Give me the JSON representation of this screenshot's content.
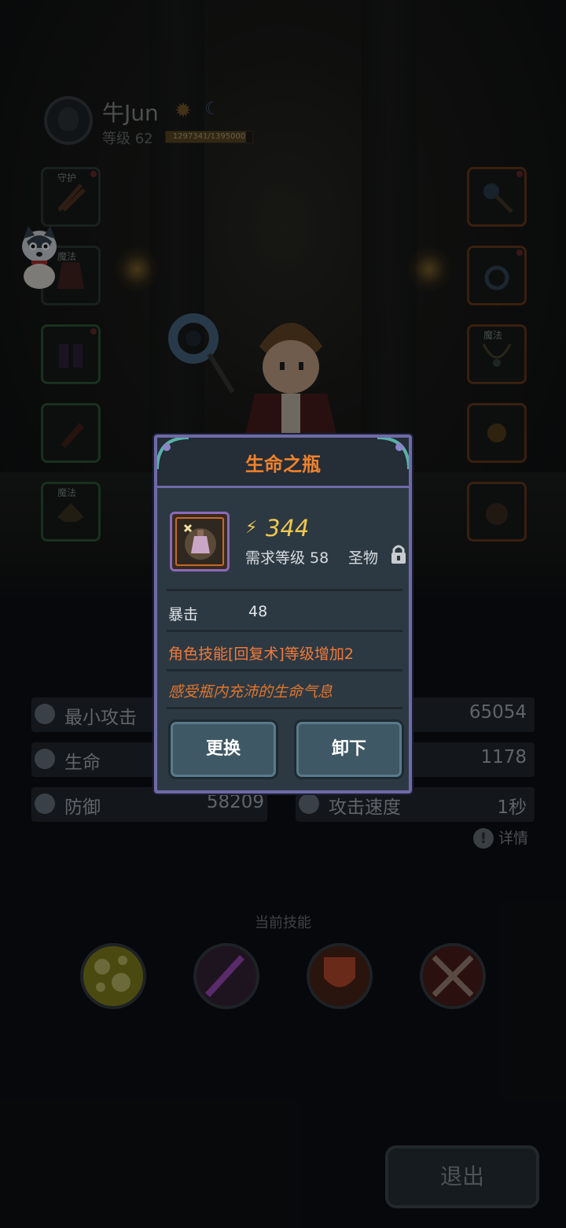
{
  "player": {
    "name": "牛Jun",
    "level_label": "等级 62",
    "xp_text": "1297341/1395000",
    "xp_fraction": 0.93,
    "rank_icon": "sun-badge-icon",
    "moon_icon": "crescent-moon-icon"
  },
  "equipment": {
    "left_slots": [
      {
        "name": "slot-guard-weapon",
        "tag": "守护",
        "icon": "twin-blades-icon"
      },
      {
        "name": "slot-armor",
        "tag": "魔法",
        "icon": "robe-icon"
      },
      {
        "name": "slot-boots",
        "tag": "",
        "icon": "boots-icon"
      },
      {
        "name": "slot-bracer",
        "tag": "",
        "icon": "bracer-icon"
      },
      {
        "name": "slot-helmet",
        "tag": "魔法",
        "icon": "helmet-icon"
      }
    ],
    "right_slots": [
      {
        "name": "slot-staff",
        "tag": "",
        "icon": "staff-icon"
      },
      {
        "name": "slot-ring",
        "tag": "",
        "icon": "ring-icon"
      },
      {
        "name": "slot-necklace",
        "tag": "魔法",
        "icon": "necklace-icon"
      },
      {
        "name": "slot-amulet",
        "tag": "",
        "icon": "amulet-icon"
      },
      {
        "name": "slot-relic",
        "tag": "",
        "icon": "bottle-icon"
      }
    ]
  },
  "stats": {
    "min_attack_label": "最小攻击",
    "min_attack_value": "65054",
    "hp_label": "生命",
    "hp_value": "1178",
    "defense_label": "防御",
    "defense_value": "58209",
    "attack_speed_label": "攻击速度",
    "attack_speed_value": "1秒",
    "details_label": "详情"
  },
  "skills": {
    "title": "当前技能",
    "icons": [
      "bubbles-skill-icon",
      "dark-sword-skill-icon",
      "fire-shield-skill-icon",
      "crossed-axes-skill-icon"
    ]
  },
  "exit_label": "退出",
  "dialog": {
    "title": "生命之瓶",
    "power": "344",
    "requirement": "需求等级 58",
    "rarity": "圣物",
    "attribute_label": "暴击",
    "attribute_value": "48",
    "effect": "角色技能[回复术]等级增加2",
    "flavor": "感受瓶内充沛的生命气息",
    "replace_label": "更换",
    "unequip_label": "卸下"
  },
  "colors": {
    "dialog_bg": "#2d3942",
    "dialog_border": "#6e6aa8",
    "title_orange": "#f0822c",
    "power_gold": "#f0c850",
    "button_bg": "#3f5866"
  }
}
